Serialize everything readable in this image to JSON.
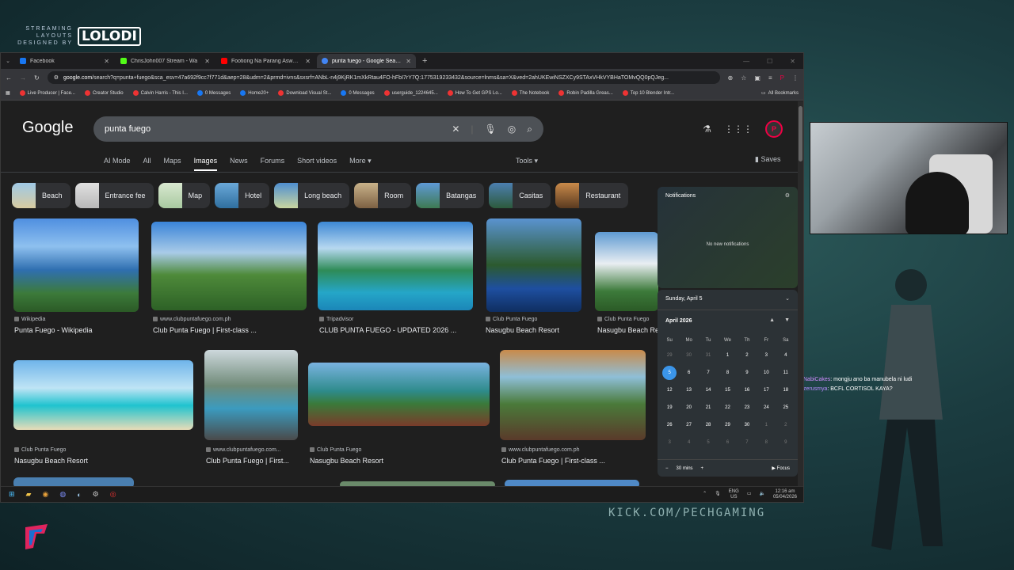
{
  "overlay": {
    "logo_small": "STREAMING LAYOUTS DESIGNED BY",
    "logo_brand": "LOLODI",
    "kick_url": "KICK.COM/PECHGAMING",
    "chat": [
      {
        "user": "NabiCakes",
        "msg": ": mongju ano ba manubela ni ludi"
      },
      {
        "user": "zerusmya",
        "msg": ": BCFL CORTISOL KAYA?"
      }
    ]
  },
  "browser": {
    "tabs": [
      {
        "label": "Facebook",
        "color": "#1877f2",
        "active": false
      },
      {
        "label": "ChrisJohn007 Stream - Wa",
        "color": "#53fc18",
        "active": false
      },
      {
        "label": "Footiong Na Parang Aswang -",
        "color": "#ff0000",
        "active": false
      },
      {
        "label": "punta fuego - Google Search",
        "color": "#4285f4",
        "active": true
      }
    ],
    "url_host": "google.com",
    "url_rest": "/search?q=punta+fuego&sca_esv=47a692f9cc7f771d&aep=28&udm=2&prmd=ivns&sxsrf=ANbL-n4j9KjRK1mXkRtau4FO-hFbI7rY7Q:1775319233432&source=lnms&sa=X&ved=2ahUKEwiNSZXCy9STAxVHkVYBHaTOMvQQ0pQJeg...",
    "bookmarks": [
      "Live Producer | Face...",
      "Creator Studio",
      "Calvin Harris - This I...",
      "0 Messages",
      "Home20+",
      "Download Visual St...",
      "0 Messages",
      "userguide_1224645...",
      "How To Get GPS Lo...",
      "The Notebook",
      "Robin Padilla Greas...",
      "Top 10 Blender Intr..."
    ],
    "all_bookmarks": "All Bookmarks"
  },
  "google": {
    "logo": "Google",
    "query": "punta fuego",
    "nav": [
      "AI Mode",
      "All",
      "Maps",
      "Images",
      "News",
      "Forums",
      "Short videos",
      "More"
    ],
    "active_nav": "Images",
    "tools": "Tools",
    "saves": "Saves",
    "chips": [
      "Beach",
      "Entrance fee",
      "Map",
      "Hotel",
      "Long beach",
      "Room",
      "Batangas",
      "Casitas",
      "Restaurant"
    ],
    "results": [
      {
        "src": "Wikipedia",
        "title": "Punta Fuego - Wikipedia"
      },
      {
        "src": "www.clubpuntafuego.com.ph",
        "title": "Club Punta Fuego | First-class ..."
      },
      {
        "src": "Tripadvisor",
        "title": "CLUB PUNTA FUEGO - UPDATED 2026 ..."
      },
      {
        "src": "Club Punta Fuego",
        "title": "Nasugbu Beach Resort"
      },
      {
        "src": "Club Punta Fuego",
        "title": "Nasugbu Beach Re"
      },
      {
        "src": "Club Punta Fuego",
        "title": "Nasugbu Beach Resort"
      },
      {
        "src": "www.clubpuntafuego.com...",
        "title": "Club Punta Fuego | First..."
      },
      {
        "src": "Club Punta Fuego",
        "title": "Nasugbu Beach Resort"
      },
      {
        "src": "www.clubpuntafuego.com.ph",
        "title": "Club Punta Fuego | First-class ..."
      }
    ]
  },
  "notifications": {
    "title": "Notifications",
    "empty": "No new notifications"
  },
  "calendar": {
    "date": "Sunday, April 5",
    "month": "April 2026",
    "weekdays": [
      "Su",
      "Mo",
      "Tu",
      "We",
      "Th",
      "Fr",
      "Sa"
    ],
    "days": [
      "29",
      "30",
      "31",
      "1",
      "2",
      "3",
      "4",
      "5",
      "6",
      "7",
      "8",
      "9",
      "10",
      "11",
      "12",
      "13",
      "14",
      "15",
      "16",
      "17",
      "18",
      "19",
      "20",
      "21",
      "22",
      "23",
      "24",
      "25",
      "26",
      "27",
      "28",
      "29",
      "30",
      "1",
      "2",
      "3",
      "4",
      "5",
      "6",
      "7",
      "8",
      "9"
    ],
    "today": "5",
    "focus_duration": "30 mins",
    "focus_label": "Focus"
  },
  "taskbar": {
    "lang": "ENG",
    "region": "US",
    "time": "12:16 am",
    "date": "05/04/2026"
  }
}
